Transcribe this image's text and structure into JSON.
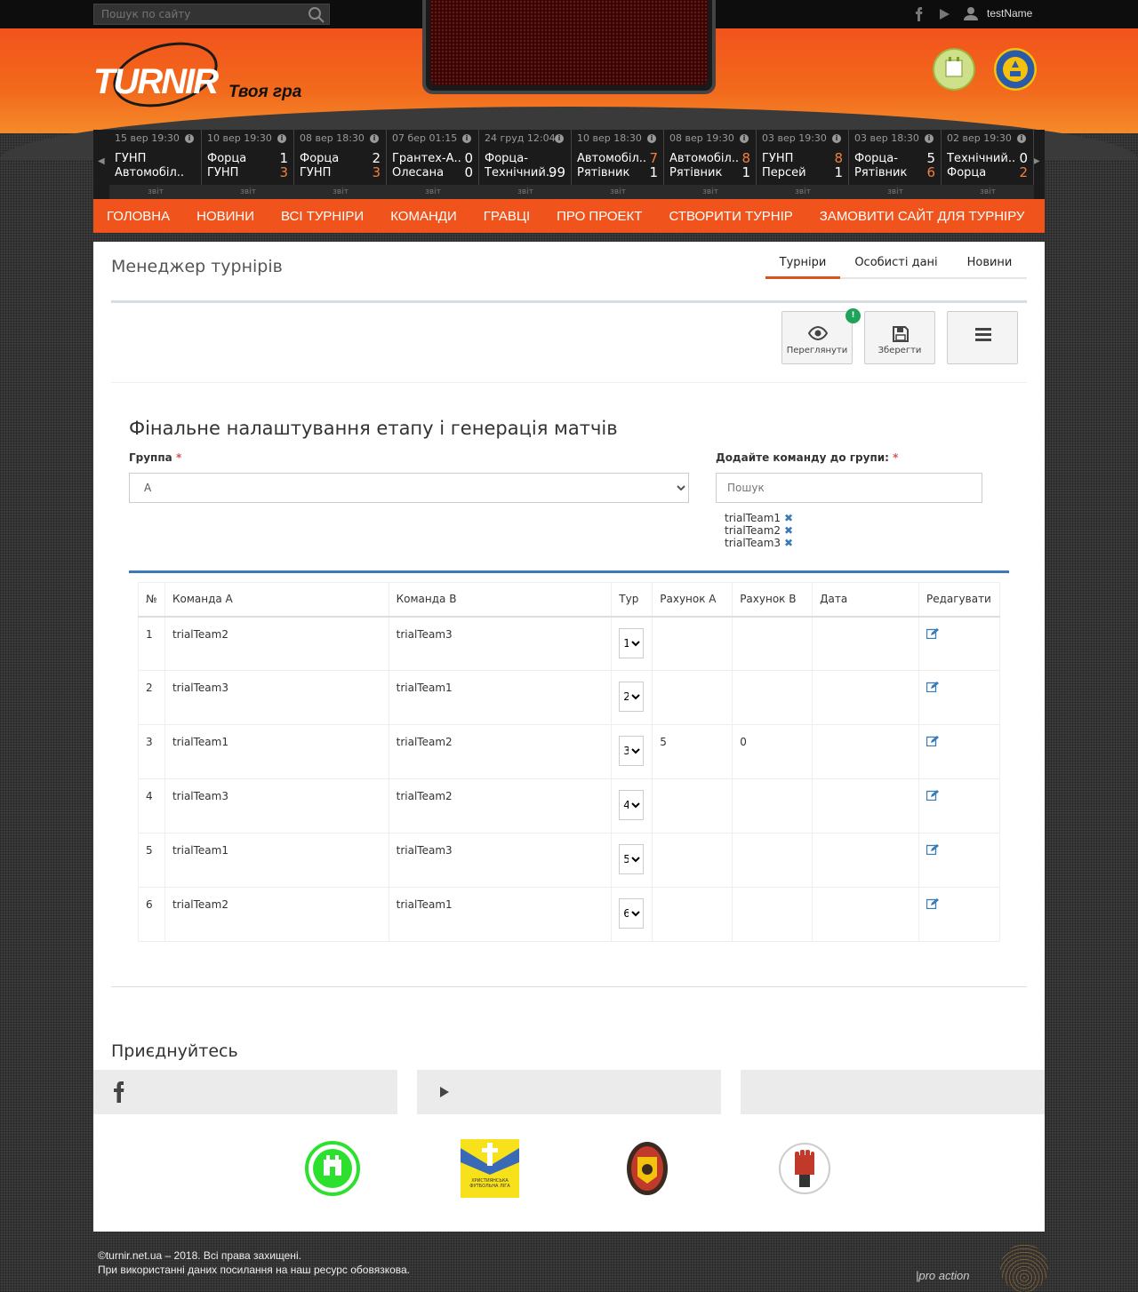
{
  "topbar": {
    "search_placeholder": "Пошук по сайту",
    "username": "testName"
  },
  "header": {
    "logo_text": "TURNIR",
    "tagline": "Твоя гра"
  },
  "results": [
    {
      "date": "15 вер 19:30",
      "team_a": "ГУНП",
      "team_b": "Автомобіл..",
      "score_a": "",
      "score_b": "",
      "report": "звіт"
    },
    {
      "date": "10 вер 19:30",
      "team_a": "Форца",
      "team_b": "ГУНП",
      "score_a": "1",
      "score_b": "3",
      "report": "звіт"
    },
    {
      "date": "08 вер 18:30",
      "team_a": "Форца",
      "team_b": "ГУНП",
      "score_a": "2",
      "score_b": "3",
      "report": "звіт"
    },
    {
      "date": "07 бер 01:15",
      "team_a": "Грантех-А..",
      "team_b": "Олесана",
      "score_a": "0",
      "score_b": "0",
      "report": "звіт"
    },
    {
      "date": "24 груд 12:04",
      "team_a": "Форца-",
      "team_b": "Технічний..",
      "score_a": "",
      "score_b": "99",
      "report": "звіт"
    },
    {
      "date": "10 вер 18:30",
      "team_a": "Автомобіл..",
      "team_b": "Рятівник",
      "score_a": "7",
      "score_b": "1",
      "report": "звіт"
    },
    {
      "date": "08 вер 19:30",
      "team_a": "Автомобіл..",
      "team_b": "Рятівник",
      "score_a": "8",
      "score_b": "1",
      "report": "звіт"
    },
    {
      "date": "03 вер 19:30",
      "team_a": "ГУНП",
      "team_b": "Персей",
      "score_a": "8",
      "score_b": "1",
      "report": "звіт"
    },
    {
      "date": "03 вер 18:30",
      "team_a": "Форца-",
      "team_b": "Рятівник",
      "score_a": "5",
      "score_b": "6",
      "report": "звіт"
    },
    {
      "date": "02 вер 19:30",
      "team_a": "Технічний..",
      "team_b": "Форца",
      "score_a": "0",
      "score_b": "2",
      "report": "звіт"
    }
  ],
  "nav": [
    "Головна",
    "Новини",
    "Всі турніри",
    "Команди",
    "Гравці",
    "Про проект",
    "Створити турнір",
    "Замовити сайт для турніру"
  ],
  "page": {
    "title": "Менеджер турнірів",
    "tabs": [
      "Турніри",
      "Особисті дані",
      "Новини"
    ],
    "toolbar": {
      "view_label": "Переглянути",
      "save_label": "Зберегти",
      "badge": "!"
    },
    "section_title": "Фінальне налаштування етапу і генерація матчів",
    "group_label": "Группа",
    "group_value": "A",
    "add_team_label": "Додайте команду до групи:",
    "required_mark": "*",
    "search_placeholder": "Пошук",
    "group_teams": [
      "trialTeam1",
      "trialTeam2",
      "trialTeam3"
    ]
  },
  "table": {
    "headers": [
      "№",
      "Команда A",
      "Команда B",
      "Тур",
      "Рахунок A",
      "Рахунок B",
      "Дата",
      "Редагувати"
    ],
    "rows": [
      {
        "no": "1",
        "team_a": "trialTeam2",
        "team_b": "trialTeam3",
        "tour": "1",
        "score_a": "",
        "score_b": "",
        "date": ""
      },
      {
        "no": "2",
        "team_a": "trialTeam3",
        "team_b": "trialTeam1",
        "tour": "2",
        "score_a": "",
        "score_b": "",
        "date": ""
      },
      {
        "no": "3",
        "team_a": "trialTeam1",
        "team_b": "trialTeam2",
        "tour": "3",
        "score_a": "5",
        "score_b": "0",
        "date": ""
      },
      {
        "no": "4",
        "team_a": "trialTeam3",
        "team_b": "trialTeam2",
        "tour": "4",
        "score_a": "",
        "score_b": "",
        "date": ""
      },
      {
        "no": "5",
        "team_a": "trialTeam1",
        "team_b": "trialTeam3",
        "tour": "5",
        "score_a": "",
        "score_b": "",
        "date": ""
      },
      {
        "no": "6",
        "team_a": "trialTeam2",
        "team_b": "trialTeam1",
        "tour": "6",
        "score_a": "",
        "score_b": "",
        "date": ""
      }
    ]
  },
  "join": {
    "title": "Приєднуйтесь"
  },
  "partners": {
    "partner2_text": "ХРИСТИЯНСЬКА ФУТБОЛЬНА ЛІГА"
  },
  "footer": {
    "line1": "©turnir.net.ua – 2018. Всі права захищені.",
    "line2": "При використанні даних посилання на наш ресурс обовязкова.",
    "brand": "|pro action"
  },
  "colors": {
    "accent": "#f0541c",
    "link": "#3a7bb5",
    "badge": "#1ea35a"
  }
}
